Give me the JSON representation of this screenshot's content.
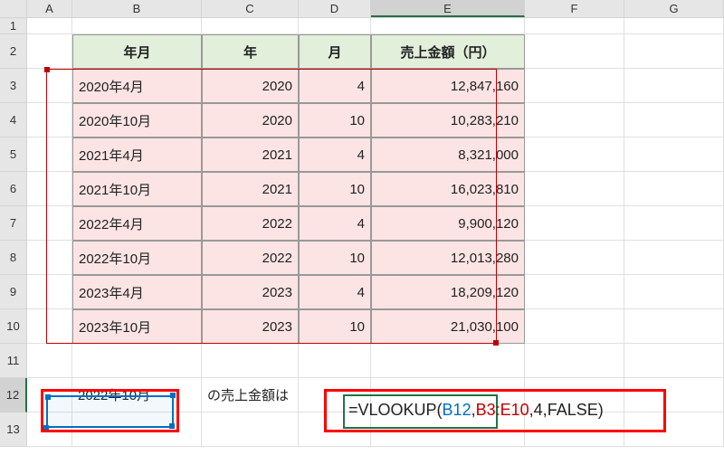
{
  "columns": [
    "A",
    "B",
    "C",
    "D",
    "E",
    "F",
    "G"
  ],
  "rows_count": 13,
  "table": {
    "headers": {
      "ym": "年月",
      "year": "年",
      "month": "月",
      "amount": "売上金額（円）"
    },
    "data": [
      {
        "ym": "2020年4月",
        "year": "2020",
        "month": "4",
        "amount": "12,847,160"
      },
      {
        "ym": "2020年10月",
        "year": "2020",
        "month": "10",
        "amount": "10,283,210"
      },
      {
        "ym": "2021年4月",
        "year": "2021",
        "month": "4",
        "amount": "8,321,000"
      },
      {
        "ym": "2021年10月",
        "year": "2021",
        "month": "10",
        "amount": "16,023,810"
      },
      {
        "ym": "2022年4月",
        "year": "2022",
        "month": "4",
        "amount": "9,900,120"
      },
      {
        "ym": "2022年10月",
        "year": "2022",
        "month": "10",
        "amount": "12,013,280"
      },
      {
        "ym": "2023年4月",
        "year": "2023",
        "month": "4",
        "amount": "18,209,120"
      },
      {
        "ym": "2023年10月",
        "year": "2023",
        "month": "10",
        "amount": "21,030,100"
      }
    ]
  },
  "lookup": {
    "value_cell": "2022年10月",
    "label": "の売上金額は",
    "formula": {
      "eq": "=",
      "name": "VLOOKUP",
      "open": "(",
      "arg1": "B12",
      "c1": ",",
      "arg2": "B3:E10",
      "c2": ",",
      "arg3": "4",
      "c3": ",",
      "arg4": "FALSE",
      "close": ")"
    }
  },
  "active_cell": "E12"
}
